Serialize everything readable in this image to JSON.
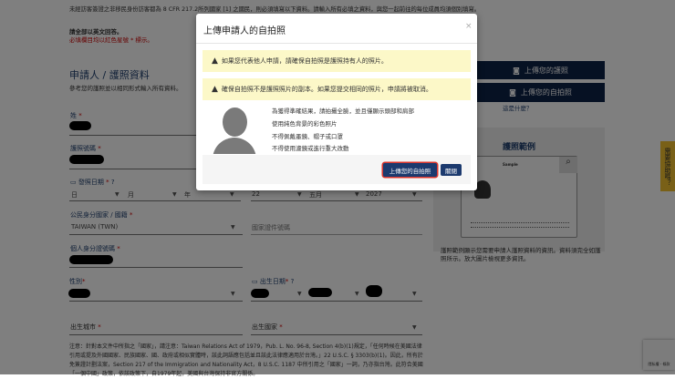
{
  "page": {
    "intro": "未經訪客簽證之非移民身份訪客都為 8 CFR 217.2所列國家 [1] 之國民，則必須填寫以下資料。請輸入所有必填之資料，與您一起前往的每位成員均須個別填寫。",
    "answer_english": "請全部以英文回答。",
    "required_note": "必填欄目均以紅色星號 * 標示。",
    "section_title": "申請人 / 護照資料",
    "section_sub": "參考您的護照並以相同形式輸入所有資料。",
    "fields": {
      "surname": "姓",
      "passport_number": "護照號碼",
      "issue_date": "發照日期",
      "issue_day": "日",
      "issue_month": "月",
      "issue_year": "年",
      "expiry_day": "22",
      "expiry_month": "五月",
      "expiry_year": "2027",
      "citizenship": "公民身分國家 / 國籍",
      "citizenship_value": "TAIWAN (TWN)",
      "national_id_country": "國家證件號碼",
      "personal_id": "個人身分證號碼",
      "gender": "性別",
      "birth_date": "出生日期",
      "birth_city": "出生城市",
      "birth_country": "出生國家"
    },
    "required_mark": "*",
    "footnote": "注意：針對本文件中所指之「國家」，請注意：Taiwan Relations Act of 1979，Pub. L. No. 96-8, Section 4(b)(1)規定，「任何時候在美國法律引用或提及外國國家、民族國家、國、政府或相似實體時，該此詞語應包括並且該此法律應適用於台灣。」22 U.S.C. § 3303(b)(1)。因此，所有於免簽證計劃法案，Section 217 of the Immigration and Nationality Act，8 U.S.C. 1187 中所引用之「國家」一詞，乃亦指台灣。此符合美國「一個中國」政策，依該政策下，自1979年起，美國與台灣保持非官方關係。",
    "upload_passport": "上傳您的護照",
    "upload_selfie": "上傳您的自拍照",
    "whats_this": "這是什麼？",
    "example_title": "護照範例",
    "example_sample": "Sample",
    "example_caption": "護照範例顯示您需要申請人護照資料的資訊。資料須完全如護照所示。放大圖片檢視更多資訊。",
    "side_tab": "需要協助嗎？",
    "recaptcha": "隱私權 - 條款"
  },
  "modal": {
    "title": "上傳申請人的自拍照",
    "close_x": "×",
    "alerts": [
      "如果您代表他人申請，請確保自拍照是護照持有人的照片。",
      "確保自拍照不是護照照片的副本。如果您提交相同的照片，申請將被取消。"
    ],
    "guidelines": [
      "為獲得準確結果，請拍攝全臉，並且僅顯示頭部和肩部",
      "使用純色背景的彩色照片",
      "不得佩戴墨鏡、帽子或口罩",
      "不得使用濾鏡或進行重大改動"
    ],
    "upload_button": "上傳您的自拍照",
    "close_button": "關閉"
  },
  "colors": {
    "navy": "#0d2247",
    "alert_bg": "#fcf8c8",
    "required": "#cc0000",
    "focus_ring": "#d9342b"
  }
}
